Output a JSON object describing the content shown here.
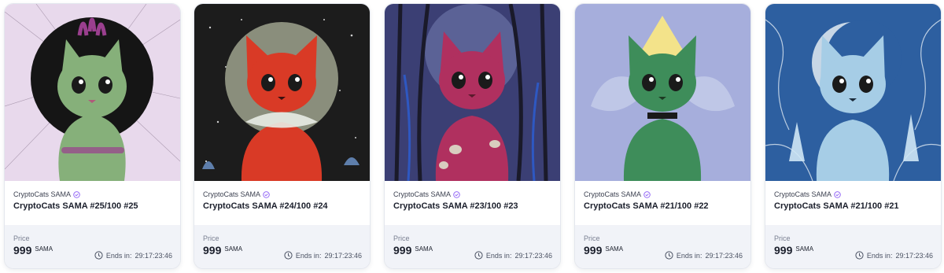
{
  "listings": [
    {
      "collection": "CryptoCats SAMA",
      "title": "CryptoCats SAMA #25/100 #25",
      "price_label": "Price",
      "price": "999",
      "currency": "SAMA",
      "ends_label": "Ends in:",
      "ends_value": "29:17:23:46",
      "art": {
        "bg": "#e8d9ec",
        "cat": "#86b07a",
        "accent": "#9a3f8e",
        "halo": "#151515"
      }
    },
    {
      "collection": "CryptoCats SAMA",
      "title": "CryptoCats SAMA #24/100 #24",
      "price_label": "Price",
      "price": "999",
      "currency": "SAMA",
      "ends_label": "Ends in:",
      "ends_value": "29:17:23:46",
      "art": {
        "bg": "#1c1c1c",
        "cat": "#d93a26",
        "accent": "#e8ece6",
        "halo": "#8a8e7c"
      }
    },
    {
      "collection": "CryptoCats SAMA",
      "title": "CryptoCats SAMA #23/100 #23",
      "price_label": "Price",
      "price": "999",
      "currency": "SAMA",
      "ends_label": "Ends in:",
      "ends_value": "29:17:23:46",
      "art": {
        "bg": "#3b3f74",
        "cat": "#b0305f",
        "accent": "#5a1a2c",
        "halo": "#7c86b8"
      }
    },
    {
      "collection": "CryptoCats SAMA",
      "title": "CryptoCats SAMA #21/100 #22",
      "price_label": "Price",
      "price": "999",
      "currency": "SAMA",
      "ends_label": "Ends in:",
      "ends_value": "29:17:23:46",
      "art": {
        "bg": "#a6aedc",
        "cat": "#3e8d5a",
        "accent": "#f3e38a",
        "halo": "#c6cdea"
      }
    },
    {
      "collection": "CryptoCats SAMA",
      "title": "CryptoCats SAMA #21/100 #21",
      "price_label": "Price",
      "price": "999",
      "currency": "SAMA",
      "ends_label": "Ends in:",
      "ends_value": "29:17:23:46",
      "art": {
        "bg": "#2d5fa0",
        "cat": "#a6cde6",
        "accent": "#cfe7f5",
        "halo": "#e4ecf2"
      }
    }
  ],
  "colors": {
    "verified": "#8b5cf6",
    "footer_bg": "#f1f3f8"
  }
}
